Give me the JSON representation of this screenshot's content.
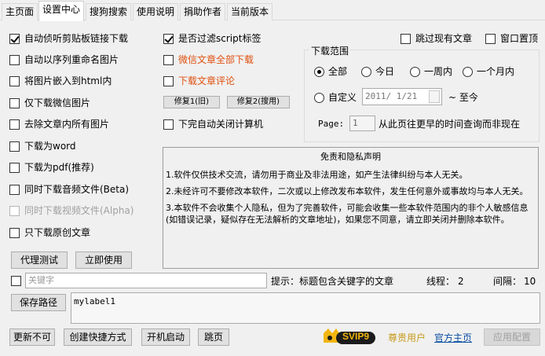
{
  "tabs": [
    "主页面",
    "设置中心",
    "搜狗搜索",
    "使用说明",
    "捐助作者",
    "当前版本"
  ],
  "left_options": [
    {
      "label": "自动侦听剪贴板链接下载",
      "checked": true,
      "disabled": false
    },
    {
      "label": "自动以序列重命名图片",
      "checked": false,
      "disabled": false
    },
    {
      "label": "将图片嵌入到html内",
      "checked": false,
      "disabled": false
    },
    {
      "label": "仅下载微信图片",
      "checked": false,
      "disabled": false
    },
    {
      "label": "去除文章内所有图片",
      "checked": false,
      "disabled": false
    },
    {
      "label": "下载为word",
      "checked": false,
      "disabled": false
    },
    {
      "label": "下载为pdf(推荐)",
      "checked": false,
      "disabled": false
    },
    {
      "label": "同时下载音频文件(Beta)",
      "checked": false,
      "disabled": false
    },
    {
      "label": "同时下载视频文件(Alpha)",
      "checked": false,
      "disabled": true
    },
    {
      "label": "只下载原创文章",
      "checked": false,
      "disabled": false
    }
  ],
  "mid_options": {
    "filter_script": {
      "label": "是否过滤script标签",
      "checked": true
    },
    "download_all": {
      "label": "微信文章全部下载",
      "checked": false
    },
    "download_comments": {
      "label": "下载文章评论",
      "checked": false
    },
    "auto_shutdown": {
      "label": "下完自动关闭计算机",
      "checked": false
    }
  },
  "repair_buttons": {
    "old": "修复1(旧)",
    "new": "修复2(搜用)"
  },
  "top_right": {
    "skip_existing": {
      "label": "跳过现有文章",
      "checked": false
    },
    "window_top": {
      "label": "窗口置顶",
      "checked": false
    }
  },
  "download_range": {
    "title": "下载范围",
    "options": [
      "全部",
      "今日",
      "一周内",
      "一个月内"
    ],
    "selected": "全部",
    "custom_label": "自定义",
    "date_value": "2011/ 1/21",
    "to_now": "~  至今",
    "page_label": "Page:",
    "page_value": "1",
    "page_hint": "从此页往更早的时间查询而非现在"
  },
  "disclaimer": {
    "title": "免责和隐私声明",
    "p1": "1.软件仅供技术交流，请勿用于商业及非法用途，如产生法律纠纷与本人无关。",
    "p2": "2.未经许可不要修改本软件，二次或以上修改发布本软件，发生任何意外或事故均与本人无关。",
    "p3": "3.本软件不会收集个人隐私，但为了完善软件，可能会收集一些本软件范围内的非个人敏感信息(如错误记录，疑似存在无法解析的文章地址)，如果您不同意，请立即关闭并删除本软件。"
  },
  "left_buttons": {
    "proxy_test": "代理测试",
    "use_now": "立即使用"
  },
  "keyword": {
    "placeholder": "关键字",
    "checked": false,
    "hint": "提示：标题包含关键字的文章",
    "threads_label": "线程：",
    "threads_value": "2",
    "interval_label": "间隔：",
    "interval_value": "10"
  },
  "save_path_button": "保存路径",
  "path_text": "mylabel1",
  "bottom": {
    "update": "更新不可",
    "shortcut": "创建快捷方式",
    "startup": "开机启动",
    "jump": "跳页",
    "vip_badge": "SVIP9",
    "vip_user": "尊贵用户",
    "homepage": "官方主页",
    "apply": "应用配置"
  }
}
